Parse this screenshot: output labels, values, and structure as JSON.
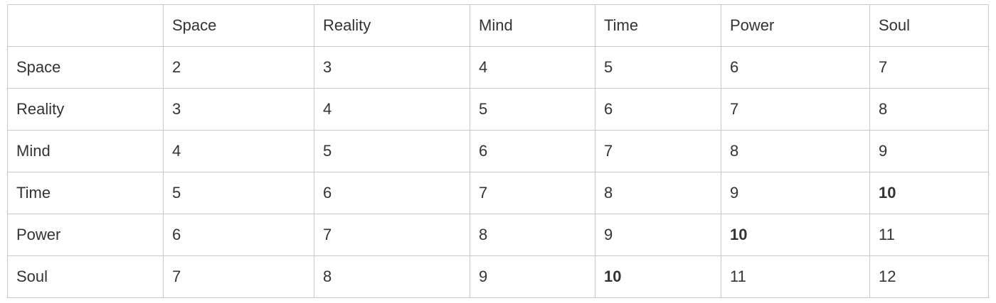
{
  "table": {
    "corner": "",
    "columns": [
      "Space",
      "Reality",
      "Mind",
      "Time",
      "Power",
      "Soul"
    ],
    "rows": [
      {
        "label": "Space",
        "cells": [
          "2",
          "3",
          "4",
          "5",
          "6",
          "7"
        ]
      },
      {
        "label": "Reality",
        "cells": [
          "3",
          "4",
          "5",
          "6",
          "7",
          "8"
        ]
      },
      {
        "label": "Mind",
        "cells": [
          "4",
          "5",
          "6",
          "7",
          "8",
          "9"
        ]
      },
      {
        "label": "Time",
        "cells": [
          "5",
          "6",
          "7",
          "8",
          "9",
          "10"
        ]
      },
      {
        "label": "Power",
        "cells": [
          "6",
          "7",
          "8",
          "9",
          "10",
          "11"
        ]
      },
      {
        "label": "Soul",
        "cells": [
          "7",
          "8",
          "9",
          "10",
          "11",
          "12"
        ]
      }
    ],
    "bold_value": "10"
  }
}
